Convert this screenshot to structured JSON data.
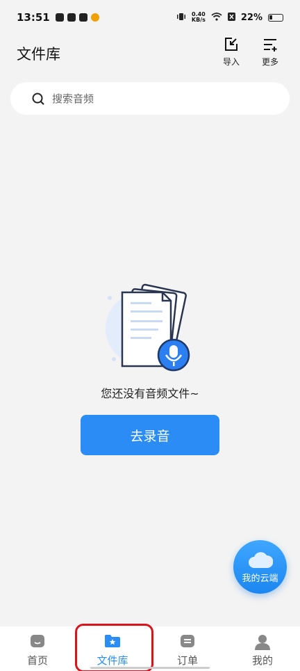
{
  "status_bar": {
    "time": "13:51",
    "net_speed_value": "0.40",
    "net_speed_unit": "KB/s",
    "battery": "22%"
  },
  "header": {
    "title": "文件库",
    "import_label": "导入",
    "more_label": "更多"
  },
  "search": {
    "placeholder": "搜索音频"
  },
  "empty_state": {
    "message": "您还没有音频文件~",
    "record_button": "去录音"
  },
  "cloud_button": {
    "label": "我的云端"
  },
  "bottom_nav": {
    "items": [
      {
        "label": "首页",
        "icon": "home-icon"
      },
      {
        "label": "文件库",
        "icon": "folder-star-icon",
        "active": true
      },
      {
        "label": "订单",
        "icon": "order-icon"
      },
      {
        "label": "我的",
        "icon": "profile-icon"
      }
    ]
  },
  "colors": {
    "accent": "#2b8cf5",
    "highlight": "#d8141c",
    "background": "#f3f3f3"
  }
}
